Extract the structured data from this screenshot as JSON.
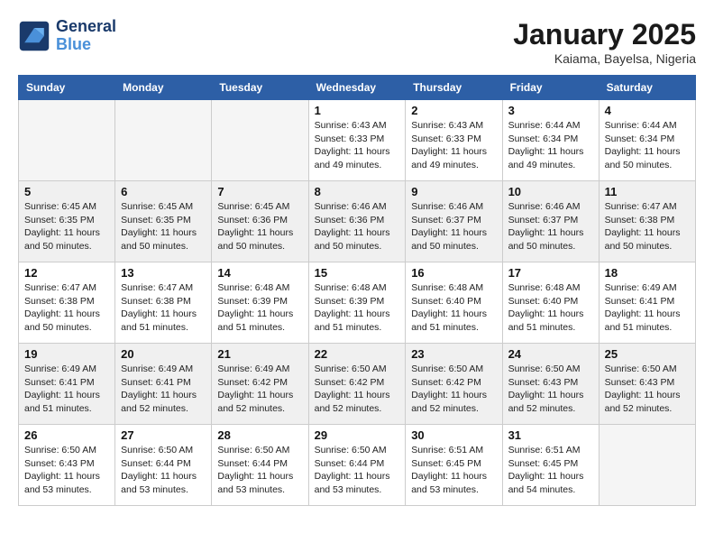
{
  "header": {
    "logo_line1": "General",
    "logo_line2": "Blue",
    "month_title": "January 2025",
    "location": "Kaiama, Bayelsa, Nigeria"
  },
  "weekdays": [
    "Sunday",
    "Monday",
    "Tuesday",
    "Wednesday",
    "Thursday",
    "Friday",
    "Saturday"
  ],
  "weeks": [
    [
      {
        "day": "",
        "info": ""
      },
      {
        "day": "",
        "info": ""
      },
      {
        "day": "",
        "info": ""
      },
      {
        "day": "1",
        "info": "Sunrise: 6:43 AM\nSunset: 6:33 PM\nDaylight: 11 hours\nand 49 minutes."
      },
      {
        "day": "2",
        "info": "Sunrise: 6:43 AM\nSunset: 6:33 PM\nDaylight: 11 hours\nand 49 minutes."
      },
      {
        "day": "3",
        "info": "Sunrise: 6:44 AM\nSunset: 6:34 PM\nDaylight: 11 hours\nand 49 minutes."
      },
      {
        "day": "4",
        "info": "Sunrise: 6:44 AM\nSunset: 6:34 PM\nDaylight: 11 hours\nand 50 minutes."
      }
    ],
    [
      {
        "day": "5",
        "info": "Sunrise: 6:45 AM\nSunset: 6:35 PM\nDaylight: 11 hours\nand 50 minutes."
      },
      {
        "day": "6",
        "info": "Sunrise: 6:45 AM\nSunset: 6:35 PM\nDaylight: 11 hours\nand 50 minutes."
      },
      {
        "day": "7",
        "info": "Sunrise: 6:45 AM\nSunset: 6:36 PM\nDaylight: 11 hours\nand 50 minutes."
      },
      {
        "day": "8",
        "info": "Sunrise: 6:46 AM\nSunset: 6:36 PM\nDaylight: 11 hours\nand 50 minutes."
      },
      {
        "day": "9",
        "info": "Sunrise: 6:46 AM\nSunset: 6:37 PM\nDaylight: 11 hours\nand 50 minutes."
      },
      {
        "day": "10",
        "info": "Sunrise: 6:46 AM\nSunset: 6:37 PM\nDaylight: 11 hours\nand 50 minutes."
      },
      {
        "day": "11",
        "info": "Sunrise: 6:47 AM\nSunset: 6:38 PM\nDaylight: 11 hours\nand 50 minutes."
      }
    ],
    [
      {
        "day": "12",
        "info": "Sunrise: 6:47 AM\nSunset: 6:38 PM\nDaylight: 11 hours\nand 50 minutes."
      },
      {
        "day": "13",
        "info": "Sunrise: 6:47 AM\nSunset: 6:38 PM\nDaylight: 11 hours\nand 51 minutes."
      },
      {
        "day": "14",
        "info": "Sunrise: 6:48 AM\nSunset: 6:39 PM\nDaylight: 11 hours\nand 51 minutes."
      },
      {
        "day": "15",
        "info": "Sunrise: 6:48 AM\nSunset: 6:39 PM\nDaylight: 11 hours\nand 51 minutes."
      },
      {
        "day": "16",
        "info": "Sunrise: 6:48 AM\nSunset: 6:40 PM\nDaylight: 11 hours\nand 51 minutes."
      },
      {
        "day": "17",
        "info": "Sunrise: 6:48 AM\nSunset: 6:40 PM\nDaylight: 11 hours\nand 51 minutes."
      },
      {
        "day": "18",
        "info": "Sunrise: 6:49 AM\nSunset: 6:41 PM\nDaylight: 11 hours\nand 51 minutes."
      }
    ],
    [
      {
        "day": "19",
        "info": "Sunrise: 6:49 AM\nSunset: 6:41 PM\nDaylight: 11 hours\nand 51 minutes."
      },
      {
        "day": "20",
        "info": "Sunrise: 6:49 AM\nSunset: 6:41 PM\nDaylight: 11 hours\nand 52 minutes."
      },
      {
        "day": "21",
        "info": "Sunrise: 6:49 AM\nSunset: 6:42 PM\nDaylight: 11 hours\nand 52 minutes."
      },
      {
        "day": "22",
        "info": "Sunrise: 6:50 AM\nSunset: 6:42 PM\nDaylight: 11 hours\nand 52 minutes."
      },
      {
        "day": "23",
        "info": "Sunrise: 6:50 AM\nSunset: 6:42 PM\nDaylight: 11 hours\nand 52 minutes."
      },
      {
        "day": "24",
        "info": "Sunrise: 6:50 AM\nSunset: 6:43 PM\nDaylight: 11 hours\nand 52 minutes."
      },
      {
        "day": "25",
        "info": "Sunrise: 6:50 AM\nSunset: 6:43 PM\nDaylight: 11 hours\nand 52 minutes."
      }
    ],
    [
      {
        "day": "26",
        "info": "Sunrise: 6:50 AM\nSunset: 6:43 PM\nDaylight: 11 hours\nand 53 minutes."
      },
      {
        "day": "27",
        "info": "Sunrise: 6:50 AM\nSunset: 6:44 PM\nDaylight: 11 hours\nand 53 minutes."
      },
      {
        "day": "28",
        "info": "Sunrise: 6:50 AM\nSunset: 6:44 PM\nDaylight: 11 hours\nand 53 minutes."
      },
      {
        "day": "29",
        "info": "Sunrise: 6:50 AM\nSunset: 6:44 PM\nDaylight: 11 hours\nand 53 minutes."
      },
      {
        "day": "30",
        "info": "Sunrise: 6:51 AM\nSunset: 6:45 PM\nDaylight: 11 hours\nand 53 minutes."
      },
      {
        "day": "31",
        "info": "Sunrise: 6:51 AM\nSunset: 6:45 PM\nDaylight: 11 hours\nand 54 minutes."
      },
      {
        "day": "",
        "info": ""
      }
    ]
  ]
}
